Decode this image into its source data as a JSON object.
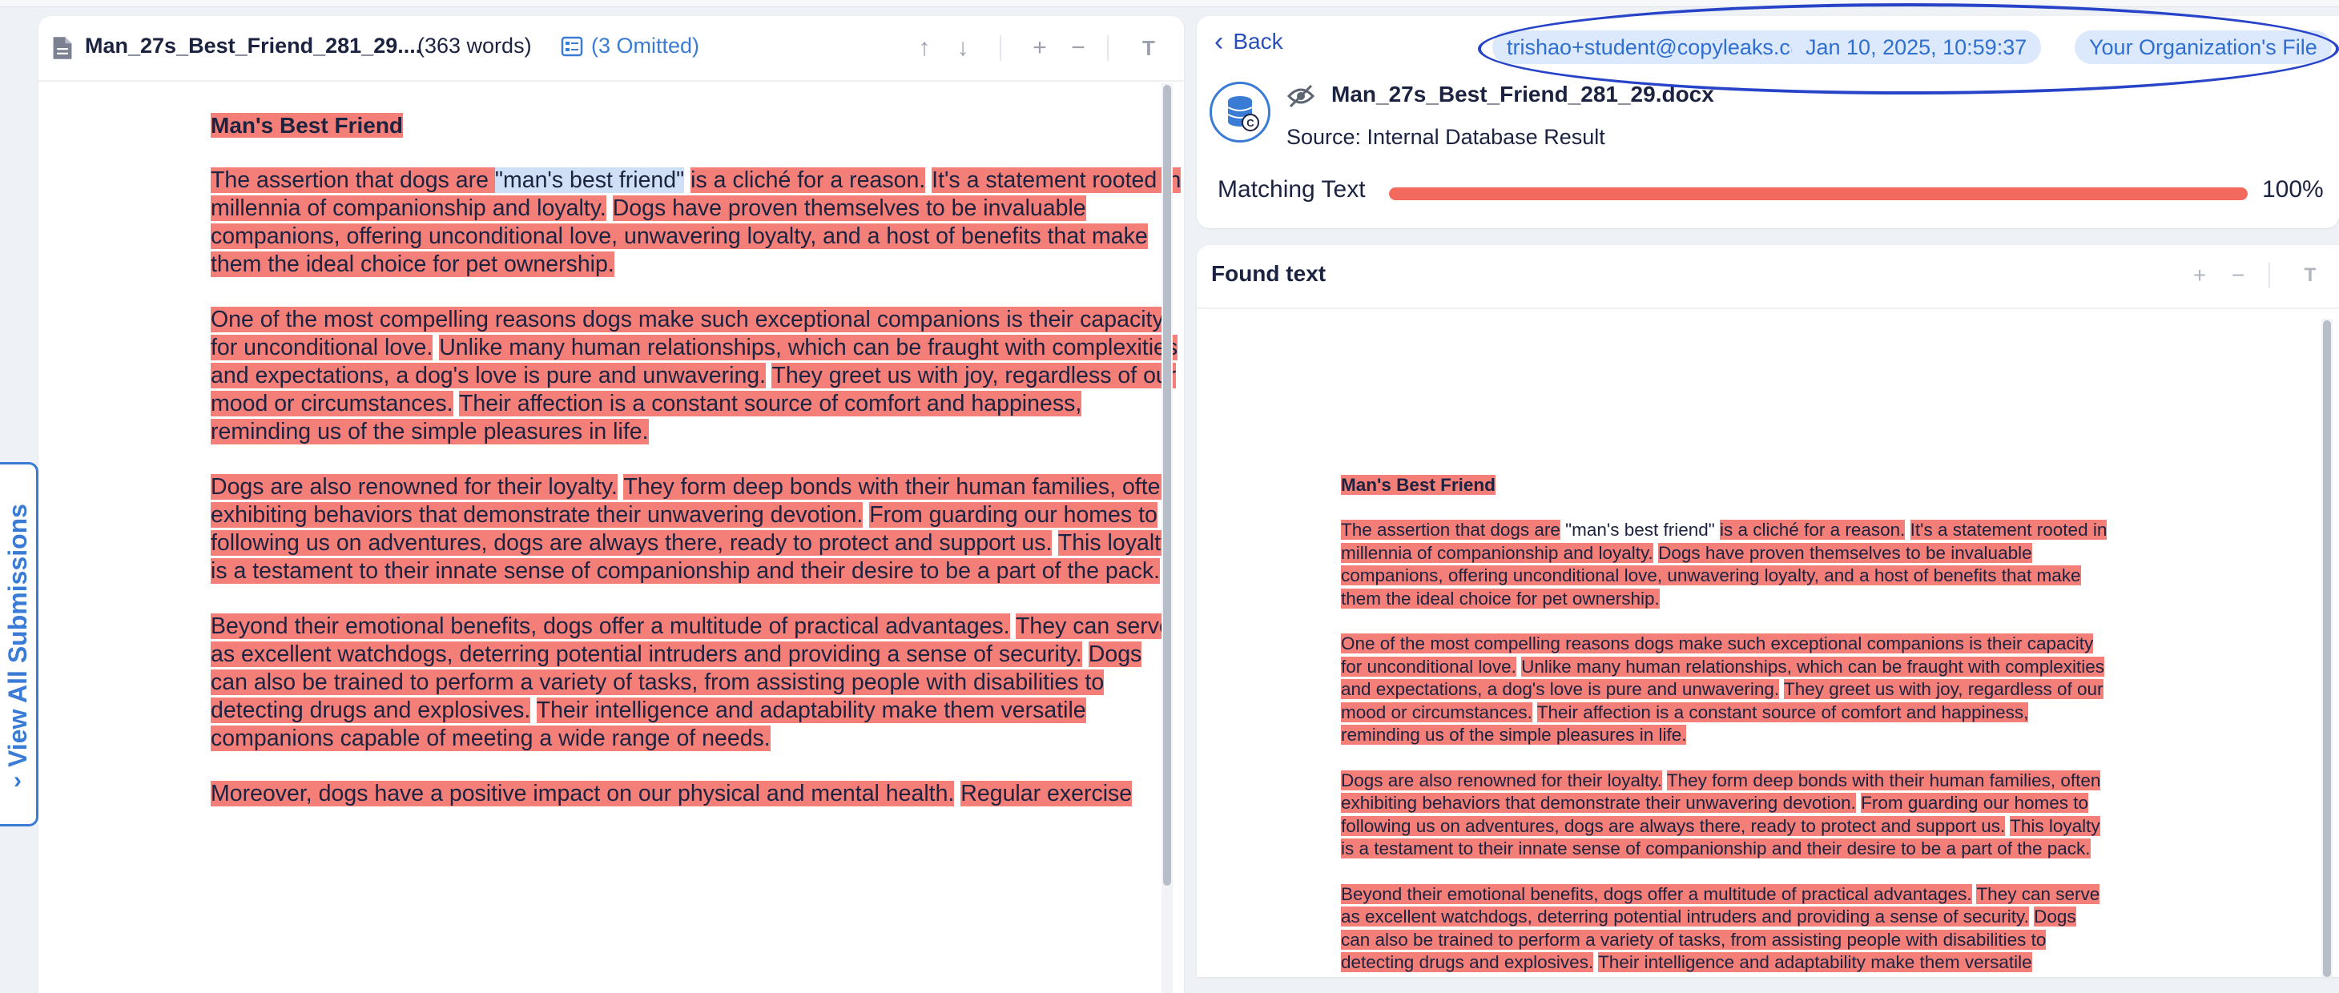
{
  "left_panel": {
    "filename": "Man_27s_Best_Friend_281_29....",
    "word_count": "(363 words)",
    "omitted": "(3 Omitted)",
    "icons": [
      "document-icon",
      "omitted-list-icon",
      "arrow-up-icon",
      "arrow-down-icon",
      "zoom-in-icon",
      "zoom-out-icon",
      "text-size-icon"
    ]
  },
  "side_tab": {
    "label": "View All Submissions"
  },
  "result_header": {
    "back_label": "Back",
    "email": "trishao+student@copyleaks.com",
    "datetime": "Jan 10, 2025, 10:59:37",
    "file_scope": "Your Organization's File",
    "filename": "Man_27s_Best_Friend_281_29.docx",
    "source": "Source: Internal Database Result",
    "matching_label": "Matching Text",
    "matching_percent": "100%",
    "matching_fraction": 1.0,
    "colors": {
      "accent": "#3a7bd5",
      "match": "#f26a5e",
      "highlight": "#f47f78",
      "annotation": "#2743c8"
    }
  },
  "found_text": {
    "title": "Found text"
  },
  "left_doc": {
    "title": "Man's Best Friend",
    "paragraphs": [
      {
        "lines": [
          [
            [
              "The assertion that dogs are ",
              "hl"
            ],
            [
              "\"man's best friend\"",
              "hl-blue"
            ],
            [
              " ",
              ""
            ],
            [
              "is a cliché for a reason.",
              "hl"
            ],
            [
              " ",
              ""
            ],
            [
              "It's a statement rooted in",
              "hl"
            ]
          ],
          [
            [
              "millennia of companionship and loyalty.",
              "hl"
            ],
            [
              " ",
              ""
            ],
            [
              "Dogs have proven themselves to be invaluable",
              "hl"
            ]
          ],
          [
            [
              "companions, offering unconditional love, unwavering loyalty, and a host of benefits that make",
              "hl"
            ]
          ],
          [
            [
              "them the ideal choice for pet ownership.",
              "hl"
            ]
          ]
        ]
      },
      {
        "lines": [
          [
            [
              "One of the most compelling reasons dogs make such exceptional companions is their capacity",
              "hl"
            ]
          ],
          [
            [
              "for unconditional love.",
              "hl"
            ],
            [
              " ",
              ""
            ],
            [
              "Unlike many human relationships, which can be fraught with complexities",
              "hl"
            ]
          ],
          [
            [
              "and expectations, a dog's love is pure and unwavering.",
              "hl"
            ],
            [
              " ",
              ""
            ],
            [
              "They greet us with joy, regardless of our",
              "hl"
            ]
          ],
          [
            [
              "mood or circumstances.",
              "hl"
            ],
            [
              " ",
              ""
            ],
            [
              "Their affection is a constant source of comfort and happiness,",
              "hl"
            ]
          ],
          [
            [
              "reminding us of the simple pleasures in life.",
              "hl"
            ]
          ]
        ]
      },
      {
        "lines": [
          [
            [
              "Dogs are also renowned for their loyalty.",
              "hl"
            ],
            [
              " ",
              ""
            ],
            [
              "They form deep bonds with their human families, often",
              "hl"
            ]
          ],
          [
            [
              "exhibiting behaviors that demonstrate their unwavering devotion.",
              "hl"
            ],
            [
              " ",
              ""
            ],
            [
              "From guarding our homes to",
              "hl"
            ]
          ],
          [
            [
              "following us on adventures, dogs are always there, ready to protect and support us.",
              "hl"
            ],
            [
              " ",
              ""
            ],
            [
              "This loyalty",
              "hl"
            ]
          ],
          [
            [
              "is a testament to their innate sense of companionship and their desire to be a part of the pack.",
              "hl"
            ]
          ]
        ]
      },
      {
        "lines": [
          [
            [
              "Beyond their emotional benefits, dogs offer a multitude of practical advantages.",
              "hl"
            ],
            [
              " ",
              ""
            ],
            [
              "They can serve",
              "hl"
            ]
          ],
          [
            [
              "as excellent watchdogs, deterring potential intruders and providing a sense of security.",
              "hl"
            ],
            [
              " ",
              ""
            ],
            [
              "Dogs",
              "hl"
            ]
          ],
          [
            [
              "can also be trained to perform a variety of tasks, from assisting people with disabilities to",
              "hl"
            ]
          ],
          [
            [
              "detecting drugs and explosives.",
              "hl"
            ],
            [
              " ",
              ""
            ],
            [
              "Their intelligence and adaptability make them versatile",
              "hl"
            ]
          ],
          [
            [
              "companions capable of meeting a wide range of needs.",
              "hl"
            ]
          ]
        ]
      },
      {
        "lines": [
          [
            [
              "Moreover, dogs have a positive impact on our physical and mental health.",
              "hl"
            ],
            [
              " ",
              ""
            ],
            [
              "Regular exercise",
              "hl"
            ]
          ]
        ]
      }
    ]
  },
  "right_doc": {
    "title": "Man's Best Friend",
    "paragraphs": [
      {
        "lines": [
          [
            [
              "The assertion that dogs are",
              "hl"
            ],
            [
              " \"man's best friend\" ",
              ""
            ],
            [
              "is a cliché for a reason.",
              "hl"
            ],
            [
              " ",
              ""
            ],
            [
              "It's a statement rooted in",
              "hl"
            ]
          ],
          [
            [
              "millennia of companionship and loyalty.",
              "hl"
            ],
            [
              " ",
              ""
            ],
            [
              "Dogs have proven themselves to be invaluable",
              "hl"
            ]
          ],
          [
            [
              "companions, offering unconditional love, unwavering loyalty, and a host of benefits that make",
              "hl"
            ]
          ],
          [
            [
              "them the ideal choice for pet ownership.",
              "hl"
            ]
          ]
        ]
      },
      {
        "lines": [
          [
            [
              "One of the most compelling reasons dogs make such exceptional companions is their capacity",
              "hl"
            ]
          ],
          [
            [
              "for unconditional love.",
              "hl"
            ],
            [
              " ",
              ""
            ],
            [
              "Unlike many human relationships, which can be fraught with complexities",
              "hl"
            ]
          ],
          [
            [
              "and expectations, a dog's love is pure and unwavering.",
              "hl"
            ],
            [
              " ",
              ""
            ],
            [
              "They greet us with joy, regardless of our",
              "hl"
            ]
          ],
          [
            [
              "mood or circumstances.",
              "hl"
            ],
            [
              " ",
              ""
            ],
            [
              "Their affection is a constant source of comfort and happiness,",
              "hl"
            ]
          ],
          [
            [
              "reminding us of the simple pleasures in life.",
              "hl"
            ]
          ]
        ]
      },
      {
        "lines": [
          [
            [
              "Dogs are also renowned for their loyalty.",
              "hl"
            ],
            [
              " ",
              ""
            ],
            [
              "They form deep bonds with their human families, often",
              "hl"
            ]
          ],
          [
            [
              "exhibiting behaviors that demonstrate their unwavering devotion.",
              "hl"
            ],
            [
              " ",
              ""
            ],
            [
              "From guarding our homes to",
              "hl"
            ]
          ],
          [
            [
              "following us on adventures, dogs are always there, ready to protect and support us.",
              "hl"
            ],
            [
              " ",
              ""
            ],
            [
              "This loyalty",
              "hl"
            ]
          ],
          [
            [
              "is a testament to their innate sense of companionship and their desire to be a part of the pack.",
              "hl"
            ]
          ]
        ]
      },
      {
        "lines": [
          [
            [
              "Beyond their emotional benefits, dogs offer a multitude of practical advantages.",
              "hl"
            ],
            [
              " ",
              ""
            ],
            [
              "They can serve",
              "hl"
            ]
          ],
          [
            [
              "as excellent watchdogs, deterring potential intruders and providing a sense of security.",
              "hl"
            ],
            [
              " ",
              ""
            ],
            [
              "Dogs",
              "hl"
            ]
          ],
          [
            [
              "can also be trained to perform a variety of tasks, from assisting people with disabilities to",
              "hl"
            ]
          ],
          [
            [
              "detecting drugs and explosives.",
              "hl"
            ],
            [
              " ",
              ""
            ],
            [
              "Their intelligence and adaptability make them versatile",
              "hl"
            ]
          ]
        ]
      }
    ]
  }
}
